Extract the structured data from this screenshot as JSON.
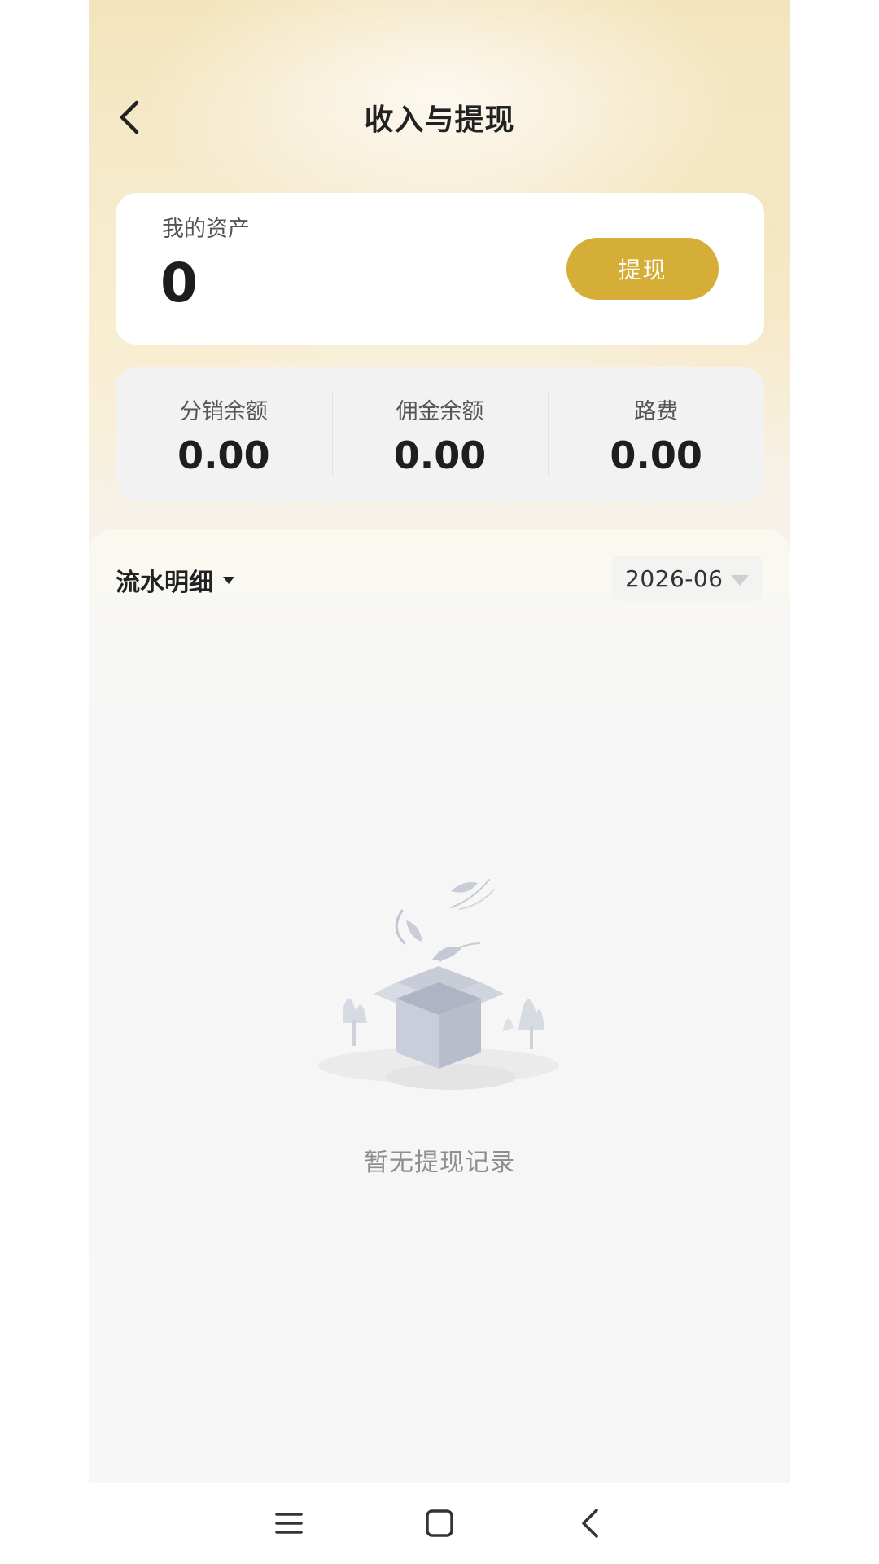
{
  "header": {
    "title": "收入与提现",
    "back_icon": "back-arrow-icon"
  },
  "assets": {
    "label": "我的资产",
    "value": "0",
    "withdraw_label": "提现"
  },
  "balances": [
    {
      "label": "分销余额",
      "value": "0.00"
    },
    {
      "label": "佣金余额",
      "value": "0.00"
    },
    {
      "label": "路费",
      "value": "0.00"
    }
  ],
  "records": {
    "title": "流水明细",
    "month": "2026-06",
    "empty_text": "暂无提现记录",
    "empty_icon": "empty-box-illustration"
  },
  "system_nav": {
    "items": [
      "menu-icon",
      "home-icon",
      "back-icon"
    ]
  },
  "colors": {
    "accent": "#d4ae36",
    "hero_gradient_top": "#f3e4bc",
    "background": "#f6f6f6"
  }
}
